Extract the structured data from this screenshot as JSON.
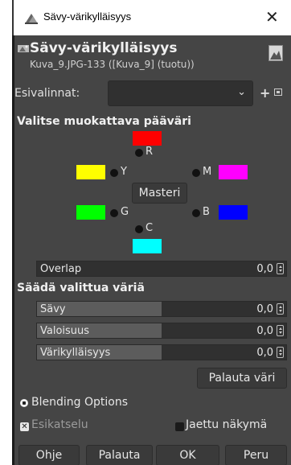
{
  "window": {
    "title": "Sävy-värikylläisyys",
    "close_glyph": "✕"
  },
  "header": {
    "title": "Sävy-värikylläisyys",
    "subtitle": "Kuva_9.JPG-133 ([Kuva_9] (tuotu))"
  },
  "presets": {
    "label": "Esivalinnat:",
    "value": "",
    "add_glyph": "+"
  },
  "primary_section": {
    "title": "Valitse muokattava pääväri",
    "colors": [
      {
        "label": "R",
        "color": "#ff0000"
      },
      {
        "label": "Y",
        "color": "#ffff00"
      },
      {
        "label": "M",
        "color": "#ff00ff"
      },
      {
        "label": "G",
        "color": "#00ff00"
      },
      {
        "label": "B",
        "color": "#0000ff"
      },
      {
        "label": "C",
        "color": "#00ffff"
      }
    ],
    "master_label": "Masteri"
  },
  "overlap": {
    "label": "Overlap",
    "value": "0,0",
    "fill_fraction": 0.0
  },
  "adjust_section": {
    "title": "Säädä valittua väriä",
    "sliders": [
      {
        "label": "Sävy",
        "value": "0,0",
        "fill_fraction": 0.5
      },
      {
        "label": "Valoisuus",
        "value": "0,0",
        "fill_fraction": 0.5
      },
      {
        "label": "Värikylläisyys",
        "value": "0,0",
        "fill_fraction": 0.5
      }
    ],
    "reset_color_label": "Palauta väri"
  },
  "blending_options": {
    "label": "Blending Options"
  },
  "preview": {
    "label": "Esikatselu",
    "checked": true
  },
  "split_view": {
    "label": "Jaettu näkymä",
    "checked": false
  },
  "buttons": {
    "help": "Ohje",
    "reset": "Palauta",
    "ok": "OK",
    "cancel": "Peru"
  }
}
